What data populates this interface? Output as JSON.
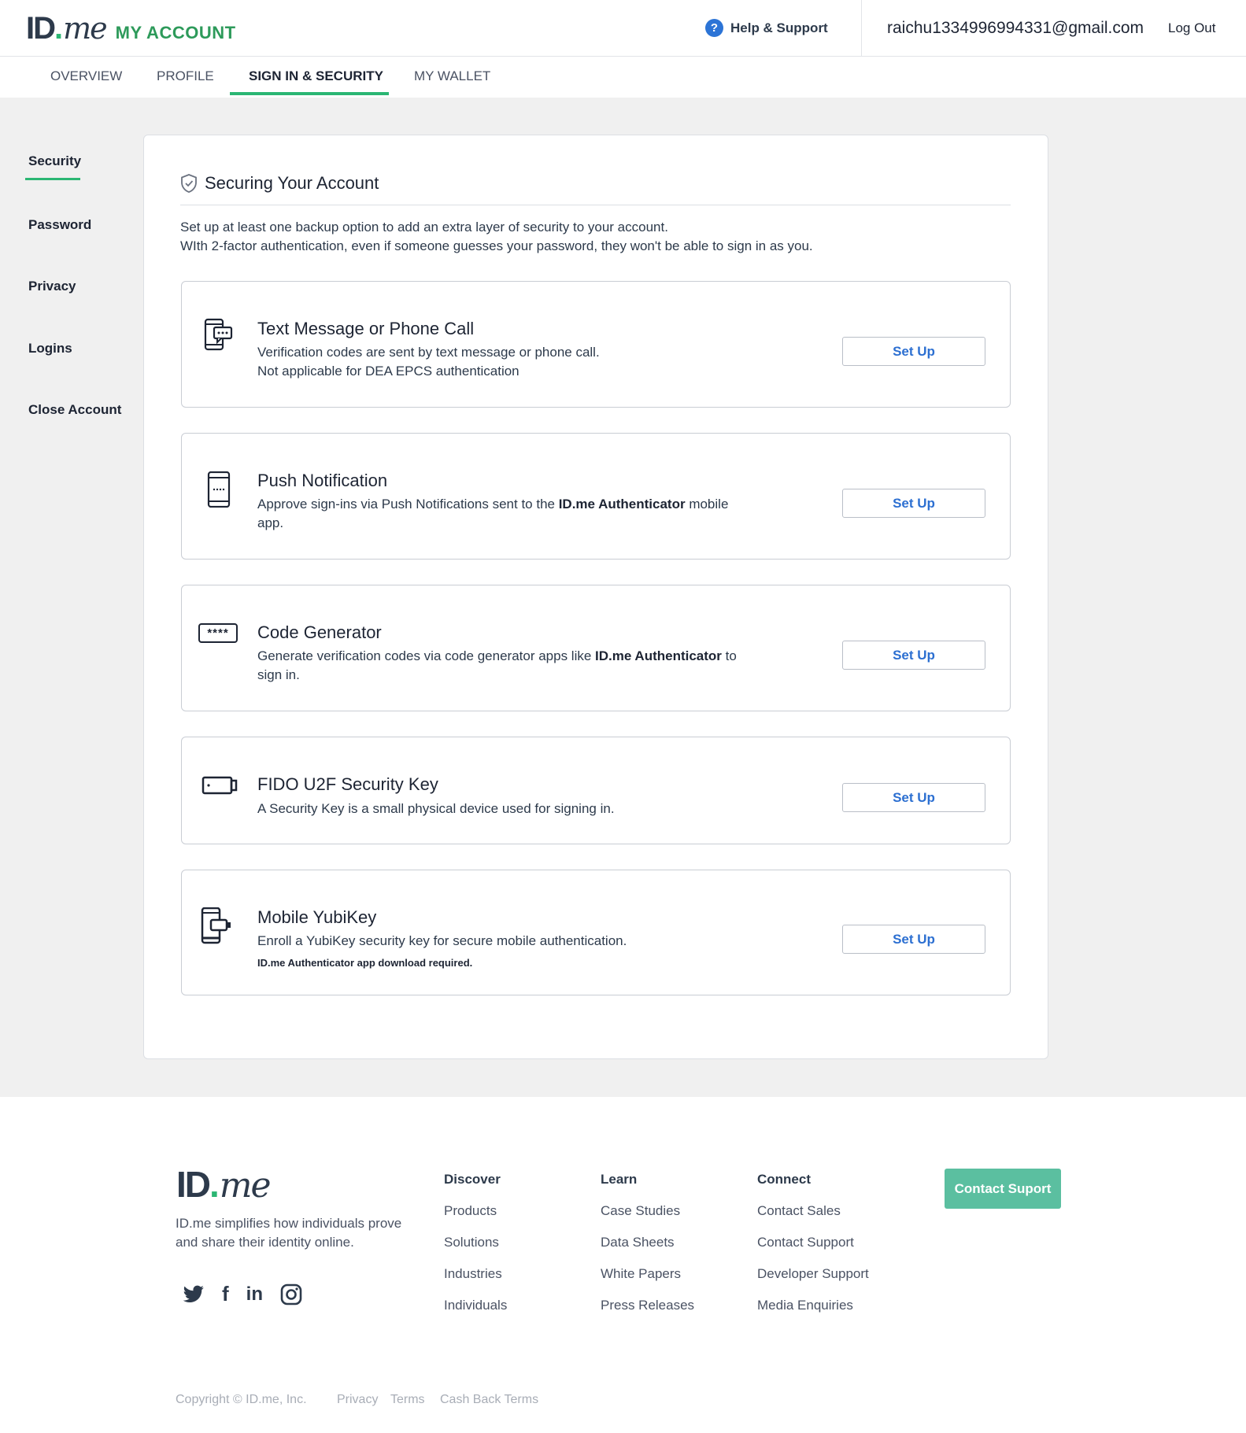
{
  "header": {
    "logo_id": "ID",
    "logo_dot": ".",
    "logo_me": "me",
    "logo_sub": "MY ACCOUNT",
    "help_label": "Help & Support",
    "help_icon_glyph": "?",
    "user_email": "raichu1334996994331@gmail.com",
    "logout_label": "Log Out"
  },
  "tabs": [
    {
      "label": "OVERVIEW",
      "active": false
    },
    {
      "label": "PROFILE",
      "active": false
    },
    {
      "label": "SIGN IN & SECURITY",
      "active": true
    },
    {
      "label": "MY WALLET",
      "active": false
    }
  ],
  "sidebar": {
    "items": [
      {
        "label": "Security",
        "active": true
      },
      {
        "label": "Password",
        "active": false
      },
      {
        "label": "Privacy",
        "active": false
      },
      {
        "label": "Logins",
        "active": false
      },
      {
        "label": "Close Account",
        "active": false
      }
    ]
  },
  "main": {
    "title": "Securing Your Account",
    "intro_line1": "Set up at least one backup option to add an extra layer of security to your account.",
    "intro_line2": "WIth 2-factor authentication, even if someone guesses your password, they won't be able to sign in as you.",
    "options": [
      {
        "icon": "sms-phone-icon",
        "title": "Text Message or Phone Call",
        "desc_line1": "Verification codes are sent by text message or phone call.",
        "desc_line2": "Not applicable for DEA EPCS authentication",
        "button": "Set Up"
      },
      {
        "icon": "mobile-phone-icon",
        "title": "Push Notification",
        "desc_pre": "Approve sign-ins via Push Notifications sent to the ",
        "desc_bold": "ID.me Authenticator",
        "desc_post": " mobile app.",
        "button": "Set Up"
      },
      {
        "icon": "password-code-icon",
        "title": "Code Generator",
        "desc_pre": "Generate verification codes via code generator apps like ",
        "desc_bold": "ID.me Authenticator",
        "desc_post": " to sign in.",
        "icon_text": "****",
        "button": "Set Up"
      },
      {
        "icon": "security-key-icon",
        "title": "FIDO U2F Security Key",
        "desc_line1": "A Security Key is a small physical device used for signing in.",
        "button": "Set Up"
      },
      {
        "icon": "mobile-yubikey-icon",
        "title": "Mobile YubiKey",
        "desc_line1": "Enroll a YubiKey security key for secure mobile authentication.",
        "note": "ID.me Authenticator app download required.",
        "button": "Set Up"
      }
    ]
  },
  "footer": {
    "tagline": "ID.me simplifies how individuals prove and share their identity online.",
    "socials": [
      "twitter-icon",
      "facebook-icon",
      "linkedin-icon",
      "instagram-icon"
    ],
    "linkedin_text": "in",
    "facebook_text": "f",
    "columns": [
      {
        "heading": "Discover",
        "links": [
          "Products",
          "Solutions",
          "Industries",
          "Individuals"
        ]
      },
      {
        "heading": "Learn",
        "links": [
          "Case Studies",
          "Data Sheets",
          "White Papers",
          "Press Releases"
        ]
      },
      {
        "heading": "Connect",
        "links": [
          "Contact Sales",
          "Contact Support",
          "Developer Support",
          "Media Enquiries"
        ]
      }
    ],
    "contact_button": "Contact Suport",
    "copyright": "Copyright © ID.me, Inc.",
    "legal_links": [
      "Privacy",
      "Terms",
      "Cash Back Terms"
    ]
  },
  "colors": {
    "brand_green": "#2bb673",
    "link_blue": "#2c6fd1",
    "contact_button": "#5bbfa0"
  }
}
